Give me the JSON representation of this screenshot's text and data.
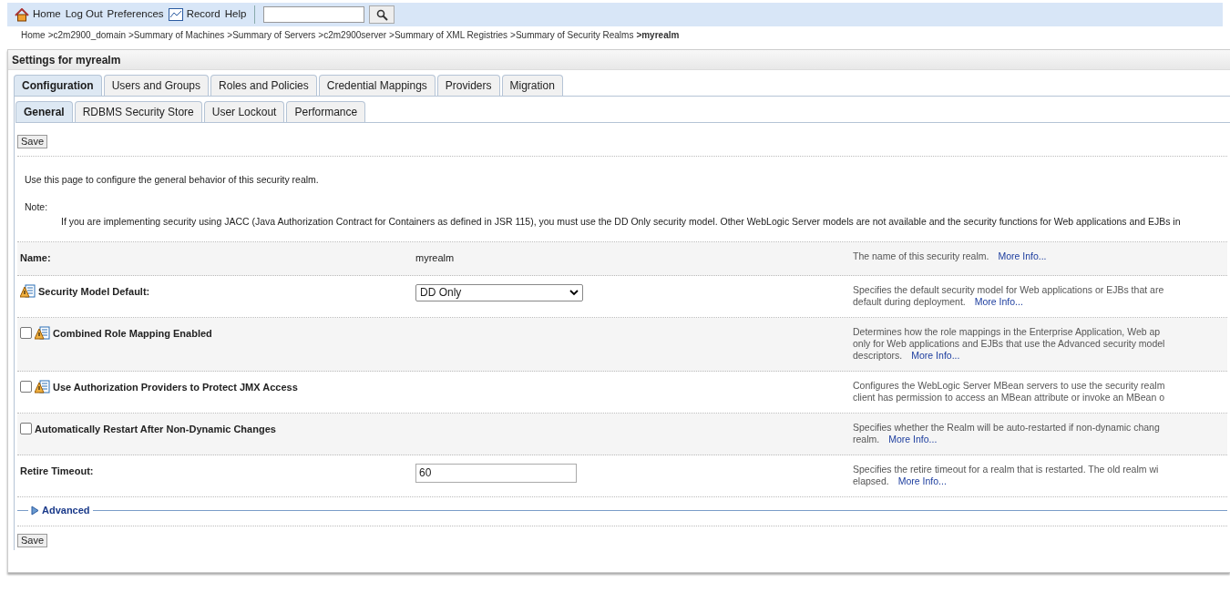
{
  "toolbar": {
    "links": [
      {
        "kind": "home",
        "label": "Home"
      },
      {
        "kind": "plain",
        "label": "Log Out"
      },
      {
        "kind": "plain",
        "label": "Preferences"
      },
      {
        "kind": "record",
        "label": "Record"
      },
      {
        "kind": "plain",
        "label": "Help"
      }
    ]
  },
  "breadcrumb": [
    {
      "label": "Home",
      "current": false
    },
    {
      "label": ">c2m2900_domain",
      "current": false
    },
    {
      "label": ">Summary of Machines",
      "current": false
    },
    {
      "label": ">Summary of Servers",
      "current": false
    },
    {
      "label": ">c2m2900server",
      "current": false
    },
    {
      "label": ">Summary of XML Registries",
      "current": false
    },
    {
      "label": ">Summary of Security Realms",
      "current": false
    },
    {
      "label": ">myrealm",
      "current": true
    }
  ],
  "panel_title": "Settings for myrealm",
  "tabs": [
    {
      "label": "Configuration",
      "selected": true
    },
    {
      "label": "Users and Groups",
      "selected": false
    },
    {
      "label": "Roles and Policies",
      "selected": false
    },
    {
      "label": "Credential Mappings",
      "selected": false
    },
    {
      "label": "Providers",
      "selected": false
    },
    {
      "label": "Migration",
      "selected": false
    }
  ],
  "subtabs": [
    {
      "label": "General",
      "selected": true
    },
    {
      "label": "RDBMS Security Store",
      "selected": false
    },
    {
      "label": "User Lockout",
      "selected": false
    },
    {
      "label": "Performance",
      "selected": false
    }
  ],
  "save_button": "Save",
  "intro": "Use this page to configure the general behavior of this security realm.",
  "note_label": "Note:",
  "note_text": "If you are implementing security using JACC (Java Authorization Contract for Containers as defined in JSR 115), you must use the DD Only security model. Other WebLogic Server models are not available and the security functions for Web applications and EJBs in",
  "fields": [
    {
      "kind": "text",
      "label": "Name:",
      "warning": false,
      "value": "myrealm",
      "help": [
        "The name of this security realm."
      ],
      "more": "More Info..."
    },
    {
      "kind": "select",
      "label": "Security Model Default:",
      "warning": true,
      "value": "DD Only",
      "help": [
        "Specifies the default security model for Web applications or EJBs that are",
        "default during deployment."
      ],
      "more": "More Info..."
    },
    {
      "kind": "checkbox",
      "label": "Combined Role Mapping Enabled",
      "warning": true,
      "checked": false,
      "help": [
        "Determines how the role mappings in the Enterprise Application, Web ap",
        "only for Web applications and EJBs that use the Advanced security model",
        "descriptors."
      ],
      "more": "More Info..."
    },
    {
      "kind": "checkbox",
      "label": "Use Authorization Providers to Protect JMX Access",
      "warning": true,
      "checked": false,
      "help": [
        "Configures the WebLogic Server MBean servers to use the security realm",
        "client has permission to access an MBean attribute or invoke an MBean o"
      ]
    },
    {
      "kind": "checkbox",
      "label": "Automatically Restart After Non-Dynamic Changes",
      "warning": false,
      "checked": false,
      "help": [
        "Specifies whether the Realm will be auto-restarted if non-dynamic chang",
        "realm."
      ],
      "more": "More Info..."
    },
    {
      "kind": "input",
      "label": "Retire Timeout:",
      "warning": false,
      "value": "60",
      "help": [
        "Specifies the retire timeout for a realm that is restarted. The old realm wi",
        "elapsed."
      ],
      "more": "More Info..."
    }
  ],
  "advanced": {
    "label": "Advanced",
    "expanded": false
  },
  "save_button_bottom": "Save"
}
